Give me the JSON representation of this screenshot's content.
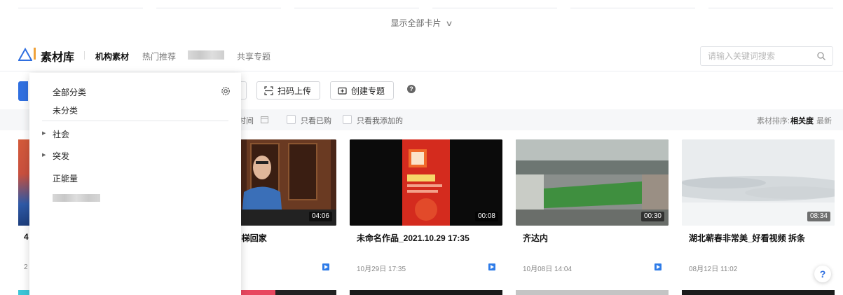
{
  "top_bar": {
    "show_all_label": "显示全部卡片",
    "chevron_icon": "chevron-down-icon"
  },
  "header": {
    "brand": "素材库",
    "nav": [
      "机构素材",
      "热门推荐",
      "共享专题"
    ],
    "search_placeholder": "请输入关键词搜索"
  },
  "toolbar": {
    "scan_upload": "扫码上传",
    "create_topic": "创建专题",
    "help": "?"
  },
  "filters": {
    "time_partial": "时间",
    "only_purchased": "只看已购",
    "only_mine": "只看我添加的",
    "sort_label": "素材排序:",
    "sort_relevance": "相关度",
    "sort_newest": "最新"
  },
  "dropdown": {
    "all": "全部分类",
    "uncategorized": "未分类",
    "items": [
      "社会",
      "突发",
      "正能量"
    ]
  },
  "left_card": {
    "title_partial": "4",
    "date_partial": "2"
  },
  "cards": [
    {
      "title": "洞\"+业主爬楼梯回家",
      "date": "",
      "duration": "04:06"
    },
    {
      "title": "未命名作品_2021.10.29 17:35",
      "date": "10月29日 17:35",
      "duration": "00:08"
    },
    {
      "title": "齐达内",
      "date": "10月08日 14:04",
      "duration": "00:30"
    },
    {
      "title": "湖北蕲春非常美_好看视频 拆条",
      "date": "08月12日 11:02",
      "duration": "08:34"
    }
  ],
  "colors": {
    "primary": "#2f6fe0",
    "accent": "#f0a23a"
  },
  "float_help": "?"
}
